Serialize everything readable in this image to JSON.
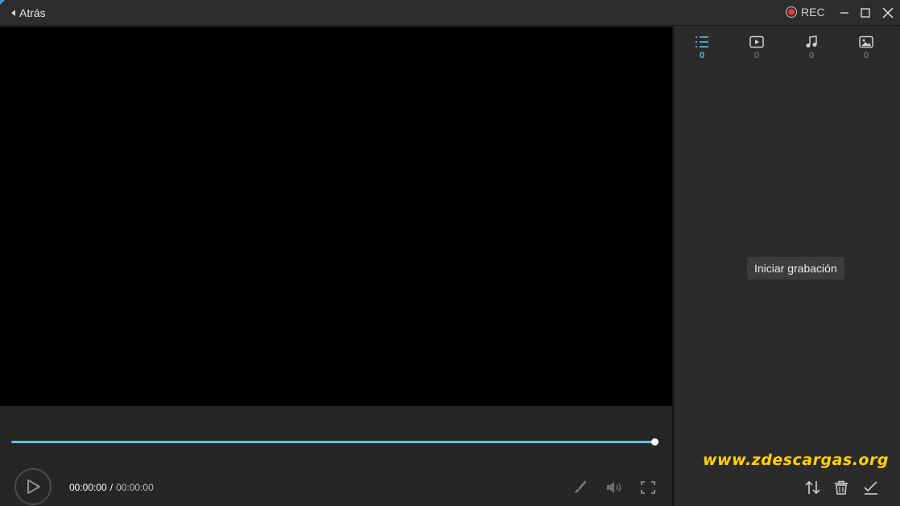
{
  "titlebar": {
    "back_label": "Atrás",
    "rec_label": "REC",
    "rec_color": "#e53935"
  },
  "player": {
    "current_time": "00:00:00",
    "separator": "/",
    "total_time": "00:00:00",
    "progress_fraction": 1.0,
    "accent_color": "#58c3dc"
  },
  "sidebar": {
    "tabs": [
      {
        "icon": "list-icon",
        "count": "0",
        "active": true
      },
      {
        "icon": "video-icon",
        "count": "0",
        "active": false
      },
      {
        "icon": "music-icon",
        "count": "0",
        "active": false
      },
      {
        "icon": "image-icon",
        "count": "0",
        "active": false
      }
    ],
    "tooltip": "Iniciar grabación"
  },
  "watermark": "www.zdescargas.org"
}
